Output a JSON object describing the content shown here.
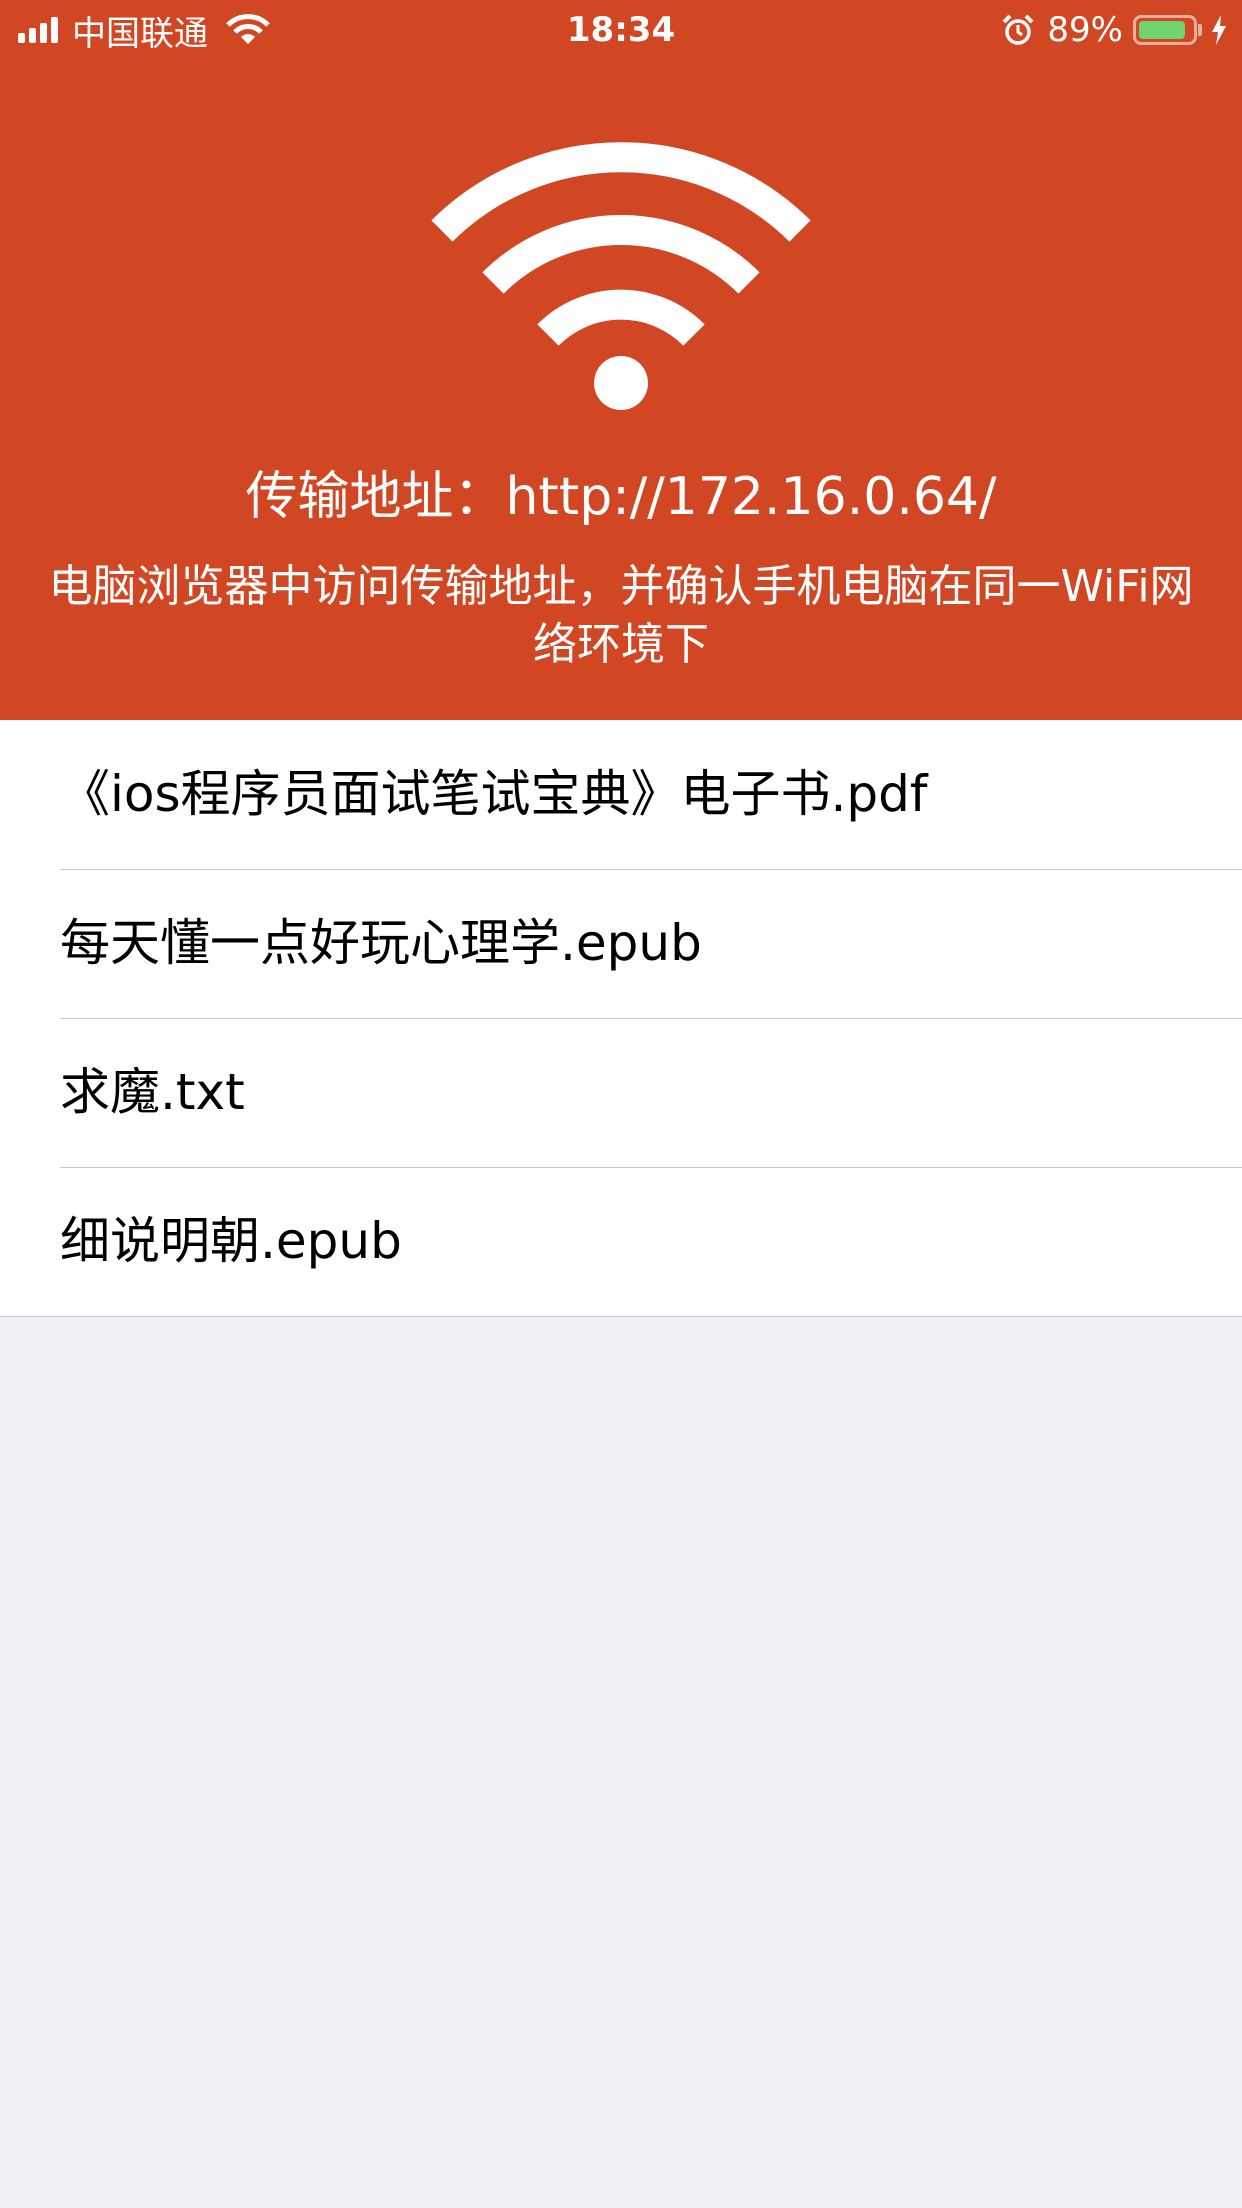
{
  "status_bar": {
    "carrier": "中国联通",
    "time": "18:34",
    "battery_percent": "89%",
    "battery_level": 0.89,
    "icons": [
      "signal-icon",
      "wifi-icon",
      "alarm-icon",
      "battery-icon",
      "charging-icon"
    ]
  },
  "header": {
    "icon": "wifi-icon",
    "address_text": "传输地址：http://172.16.0.64/",
    "hint_text": "电脑浏览器中访问传输地址，并确认手机电脑在同一WiFi网络环境下"
  },
  "files": [
    {
      "name": "《ios程序员面试笔试宝典》电子书.pdf"
    },
    {
      "name": "每天懂一点好玩心理学.epub"
    },
    {
      "name": "求魔.txt"
    },
    {
      "name": "细说明朝.epub"
    }
  ],
  "colors": {
    "header_bg": "#d14723",
    "page_bg": "#efeff4",
    "battery_fill": "#6fd46b",
    "separator": "#c8c7cc"
  }
}
